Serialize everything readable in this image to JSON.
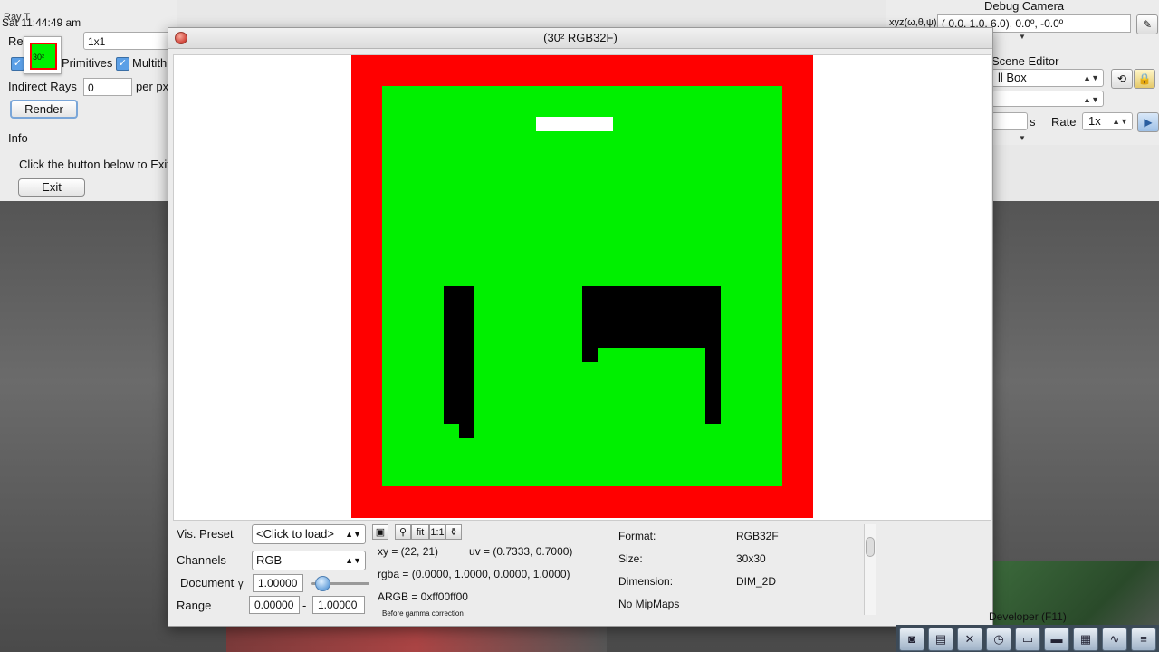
{
  "left_panel": {
    "ray_label": "Ray T",
    "time": "Sat 11:44:49 am",
    "thumb_text": "30²",
    "res_label": "Re",
    "res_value": "1x1",
    "primitives_label": "Primitives",
    "multithread_label": "Multith",
    "indirect_label": "Indirect Rays",
    "indirect_value": "0",
    "per_px": "per px",
    "render_button": "Render",
    "info_label": "Info",
    "info_text": "Click the button below to Exit",
    "exit_button": "Exit"
  },
  "camera": {
    "title": "Debug Camera",
    "xyz_label": "xyz(ω,θ,ψ)",
    "value": "( 0.0,  1.0,  6.0),  0.0º,  -0.0º",
    "scene_editor": "Scene Editor",
    "scene_value": "ll Box",
    "rate_label": "Rate",
    "rate_value": "1x",
    "time_unit": "s"
  },
  "window": {
    "title": "(30² RGB32F)"
  },
  "controls": {
    "vis_preset_label": "Vis. Preset",
    "vis_preset_value": "<Click to load>",
    "channels_label": "Channels",
    "channels_value": "RGB",
    "document_label": "Document",
    "gamma_symbol": "γ",
    "gamma_value": "1.00000",
    "range_label": "Range",
    "range_min": "0.00000",
    "range_sep": "-",
    "range_max": "1.00000",
    "tool_fit": "fit",
    "tool_11": "1:1",
    "xy": "xy =  (22, 21)",
    "uv": "uv =  (0.7333, 0.7000)",
    "rgba": "rgba =  (0.0000, 1.0000, 0.0000, 1.0000)",
    "argb": "ARGB =  0xff00ff00",
    "gamma_note": "Before gamma correction",
    "format_label": "Format:",
    "format_value": "RGB32F",
    "size_label": "Size:",
    "size_value": "30x30",
    "dimension_label": "Dimension:",
    "dimension_value": "DIM_2D",
    "mipmaps": "No MipMaps"
  },
  "dock": {
    "developer_label": "Developer (F11)"
  }
}
